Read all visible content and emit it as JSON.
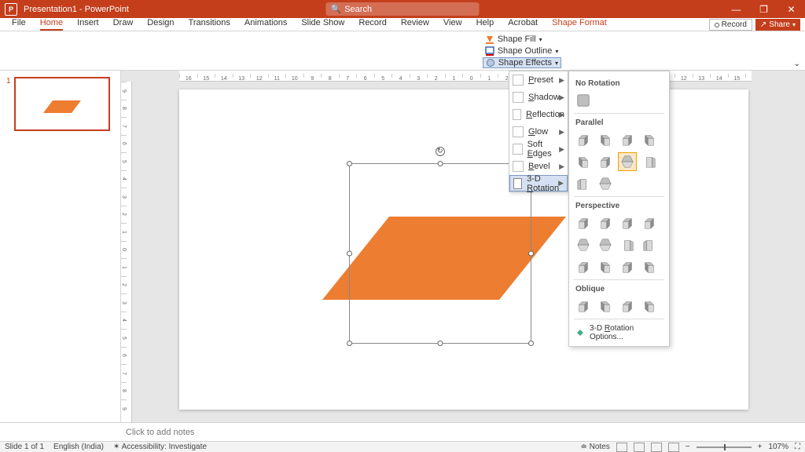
{
  "titlebar": {
    "app_icon": "P",
    "title": "Presentation1 - PowerPoint",
    "search_placeholder": "Search"
  },
  "window_controls": {
    "minimize": "—",
    "maximize": "❐",
    "close": "✕"
  },
  "tabs": {
    "file": "File",
    "home": "Home",
    "insert": "Insert",
    "draw": "Draw",
    "design": "Design",
    "transitions": "Transitions",
    "animations": "Animations",
    "slideshow": "Slide Show",
    "record": "Record",
    "review": "Review",
    "view": "View",
    "help": "Help",
    "acrobat": "Acrobat",
    "shape_format": "Shape Format"
  },
  "tab_right": {
    "record": "Record",
    "share": "Share"
  },
  "ribbon": {
    "shape_fill": "Shape Fill",
    "shape_outline": "Shape Outline",
    "shape_effects": "Shape Effects"
  },
  "effects_menu": {
    "preset": "Preset",
    "shadow": "Shadow",
    "reflection": "Reflection",
    "glow": "Glow",
    "soft_edges": "Soft Edges",
    "bevel": "Bevel",
    "rotation": "3-D Rotation"
  },
  "rotation_gallery": {
    "no_rotation": "No Rotation",
    "parallel": "Parallel",
    "perspective": "Perspective",
    "oblique": "Oblique",
    "options": "3-D Rotation Options..."
  },
  "ruler_labels": [
    "16",
    "15",
    "14",
    "13",
    "12",
    "11",
    "10",
    "9",
    "8",
    "7",
    "6",
    "5",
    "4",
    "3",
    "2",
    "1",
    "0",
    "1",
    "2",
    "3",
    "4",
    "5",
    "6",
    "7",
    "8",
    "9",
    "10",
    "11",
    "12",
    "13",
    "14",
    "15",
    "16"
  ],
  "vruler_labels": [
    "9",
    "8",
    "7",
    "6",
    "5",
    "4",
    "3",
    "2",
    "1",
    "0",
    "1",
    "2",
    "3",
    "4",
    "5",
    "6",
    "7",
    "8",
    "9"
  ],
  "notes_placeholder": "Click to add notes",
  "status": {
    "slide": "Slide 1 of 1",
    "lang": "English (India)",
    "access": "Accessibility: Investigate",
    "notes": "Notes",
    "zoom": "107%"
  },
  "thumb_number": "1",
  "colors": {
    "accent": "#c43e1c",
    "shape": "#ed7d31"
  }
}
